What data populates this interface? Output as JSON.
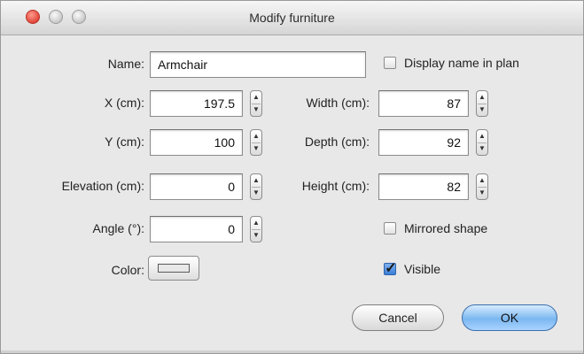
{
  "window": {
    "title": "Modify furniture"
  },
  "form": {
    "name_label": "Name:",
    "name_value": "Armchair",
    "display_name_label": "Display name in plan",
    "display_name_checked": false,
    "x_label": "X (cm):",
    "x_value": "197.5",
    "y_label": "Y (cm):",
    "y_value": "100",
    "elevation_label": "Elevation (cm):",
    "elevation_value": "0",
    "angle_label": "Angle (°):",
    "angle_value": "0",
    "width_label": "Width (cm):",
    "width_value": "87",
    "depth_label": "Depth (cm):",
    "depth_value": "92",
    "height_label": "Height (cm):",
    "height_value": "82",
    "mirrored_label": "Mirrored shape",
    "mirrored_checked": false,
    "color_label": "Color:",
    "color_value": "#e8e8e8",
    "visible_label": "Visible",
    "visible_checked": true
  },
  "buttons": {
    "cancel_label": "Cancel",
    "ok_label": "OK"
  },
  "icons": {
    "close": "close-icon",
    "minimize": "minimize-icon",
    "zoom": "zoom-icon",
    "stepper_up": "chevron-up-icon",
    "stepper_down": "chevron-down-icon",
    "check": "checkmark-icon"
  }
}
